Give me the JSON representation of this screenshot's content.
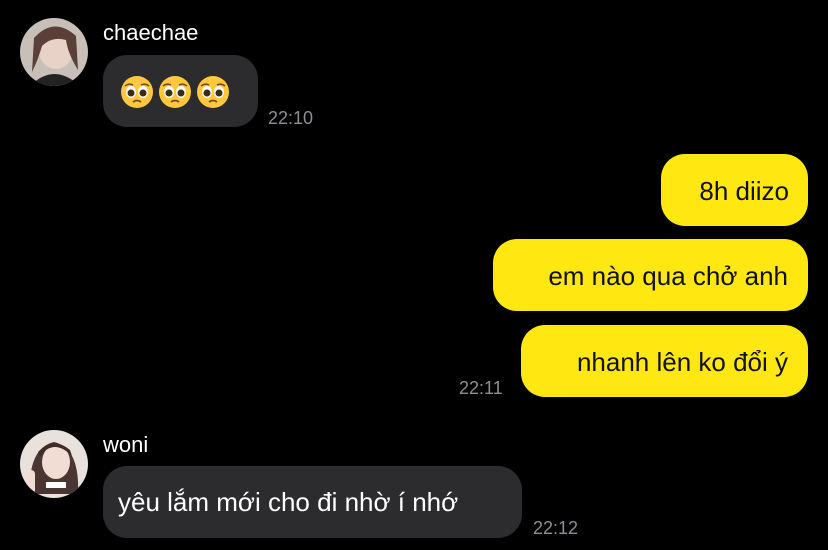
{
  "conversation": {
    "messages": [
      {
        "sender": "chaechae",
        "text": "🥺🥺🥺",
        "time": "22:10"
      },
      {
        "sender": "me",
        "text": "8h diizo"
      },
      {
        "sender": "me",
        "text": "em nào qua chở anh"
      },
      {
        "sender": "me",
        "text": "nhanh lên ko đổi ý",
        "time": "22:11"
      },
      {
        "sender": "woni",
        "text": "yêu lắm mới cho đi nhờ í nhớ",
        "time": "22:12"
      }
    ]
  },
  "colors": {
    "background": "#000000",
    "incoming_bubble": "#2c2c2e",
    "outgoing_bubble": "#ffe812",
    "timestamp": "#8e8e93"
  },
  "icons": {
    "pleading_face": "pleading-face-emoji"
  }
}
